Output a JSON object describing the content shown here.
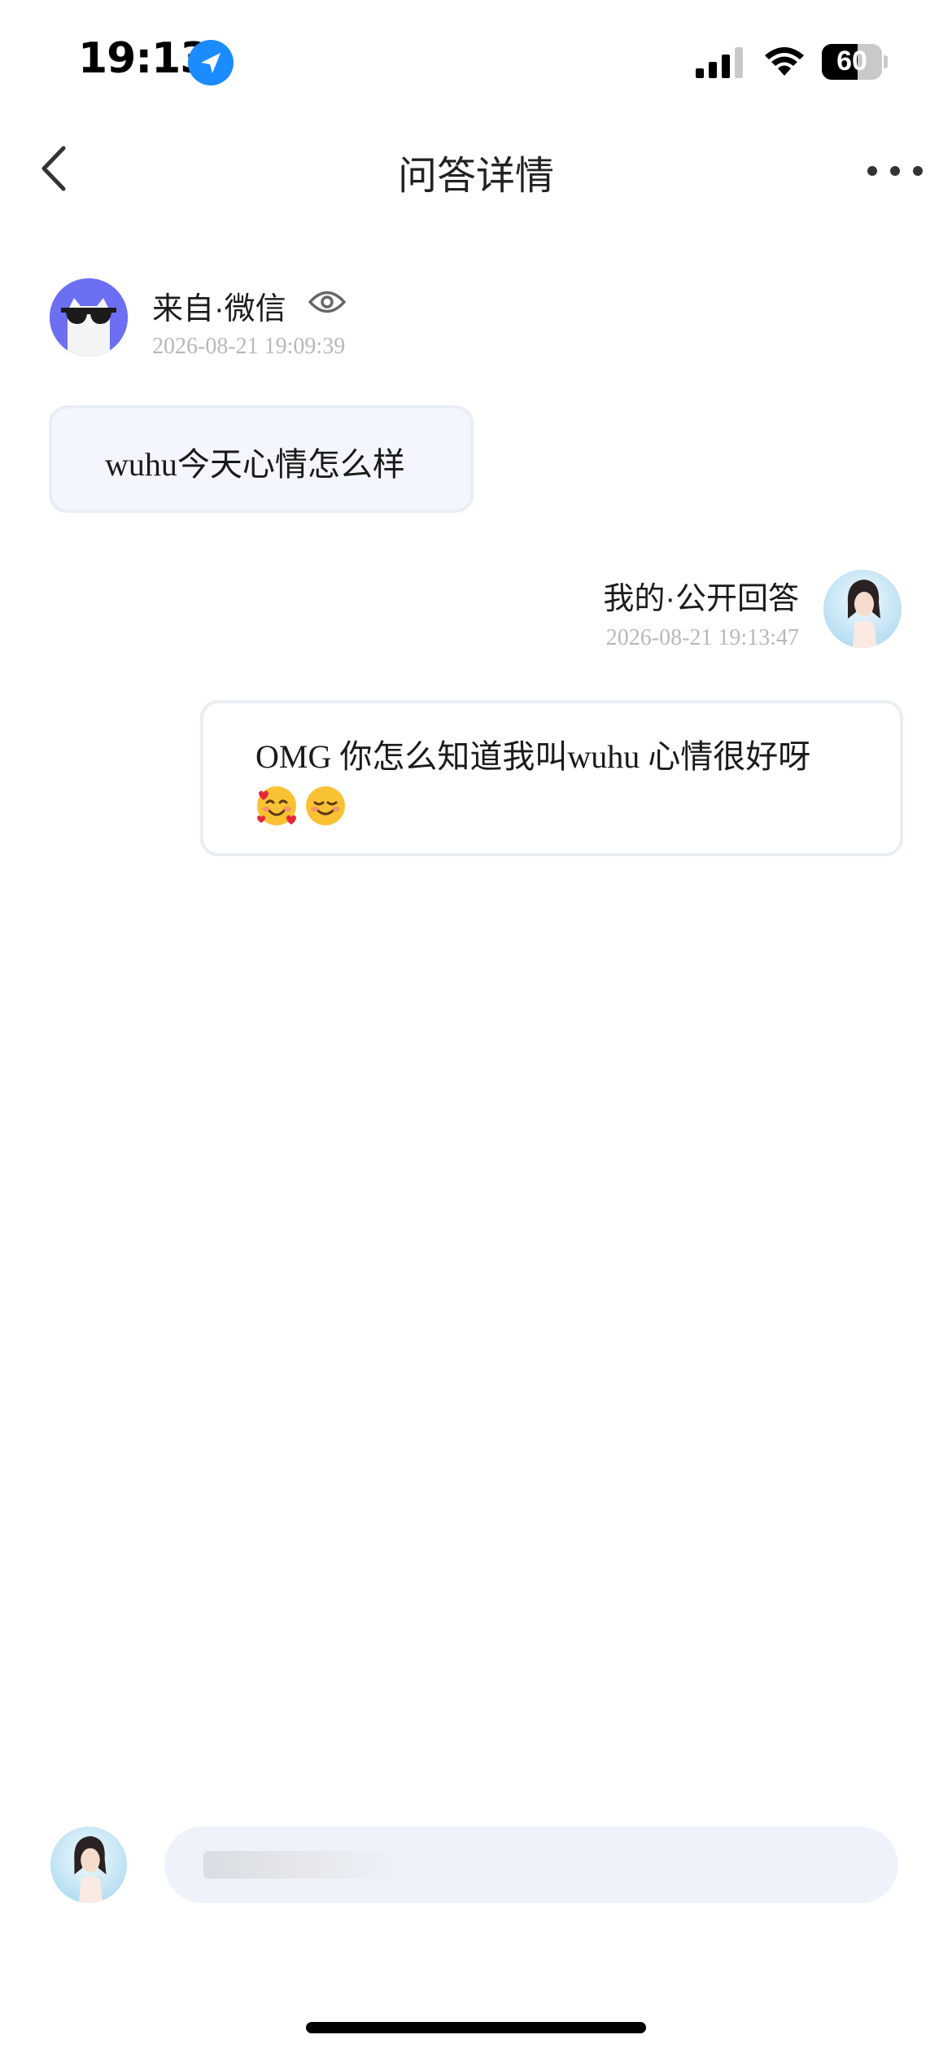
{
  "status_bar": {
    "time": "19:13",
    "battery_level": "60",
    "battery_fraction": 0.6,
    "icons": [
      "location-arrow-icon",
      "cellular-signal-icon",
      "wifi-icon",
      "battery-icon"
    ]
  },
  "nav": {
    "title": "问答详情",
    "back_icon": "chevron-left-icon",
    "more_icon": "more-dots-icon"
  },
  "question": {
    "source": "来自·微信",
    "time": "2026-08-21 19:09:39",
    "text": "wuhu今天心情怎么样",
    "avatar": "cat-sunglasses-avatar",
    "visibility_icon": "eye-icon"
  },
  "answer": {
    "label": "我的·公开回答",
    "time": "2026-08-21 19:13:47",
    "text": "OMG 你怎么知道我叫wuhu 心情很好呀",
    "emojis": "🥰☺️",
    "avatar": "user-avatar"
  },
  "composer": {
    "placeholder": "",
    "avatar": "user-avatar"
  },
  "colors": {
    "accent_blue": "#1a8cff",
    "avatar_purple": "#6c6ff2",
    "bubble_question_bg": "#f3f7fd",
    "input_bg": "#eef3fb",
    "timestamp_gray": "#b8b8b8"
  }
}
